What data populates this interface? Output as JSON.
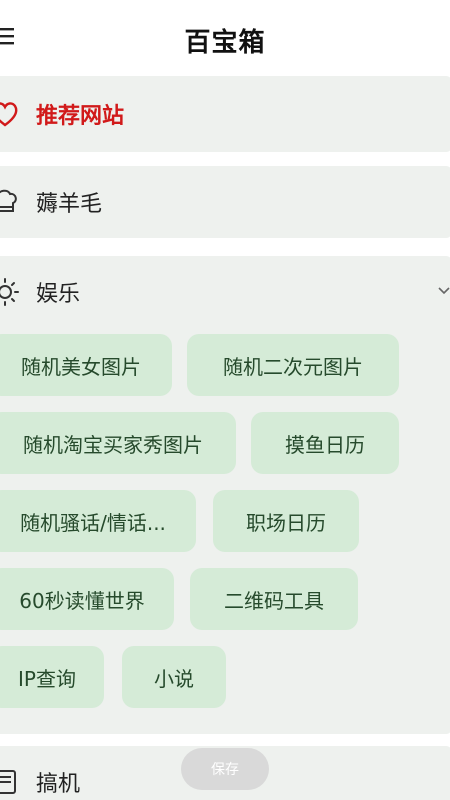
{
  "header": {
    "title": "百宝箱",
    "menu_icon": "hamburger-icon"
  },
  "sections": {
    "recommended": {
      "label": "推荐网站",
      "icon": "heart-icon",
      "color": "#d11a1a"
    },
    "freebies": {
      "label": "薅羊毛",
      "icon": "chef-hat-icon"
    },
    "entertainment": {
      "label": "娱乐",
      "icon": "sun-icon",
      "expanded": true,
      "items": [
        "随机美女图片",
        "随机二次元图片",
        "随机淘宝买家秀图片",
        "摸鱼日历",
        "随机骚话/情话...",
        "职场日历",
        "60秒读懂世界",
        "二维码工具",
        "IP查询",
        "小说"
      ]
    },
    "tinkering": {
      "label": "搞机",
      "icon": "device-icon"
    }
  },
  "save_button": {
    "label": "保存"
  },
  "colors": {
    "section_bg": "#eef1ee",
    "chip_bg": "#d5ebd7",
    "chip_text": "#264a2c"
  }
}
